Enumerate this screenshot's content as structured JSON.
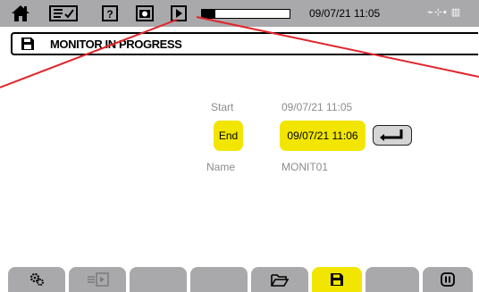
{
  "status_bar": {
    "icons": [
      "home-icon",
      "checklist-icon",
      "help-icon",
      "camera-icon",
      "play-icon"
    ],
    "recording_progress": 0.15,
    "datetime": "09/07/21 11:05",
    "status_glyphs": "⌁⊹▪ ▥"
  },
  "title": {
    "icon": "save-icon",
    "text": "MONITOR IN PROGRESS"
  },
  "form": {
    "start_label": "Start",
    "start_value": "09/07/21 11:05",
    "end_label": "End",
    "end_value": "09/07/21 11:06",
    "name_label": "Name",
    "name_value": "MONIT01",
    "enter_icon": "enter-icon"
  },
  "tabs": [
    {
      "icon": "settings-gears-icon",
      "active": false
    },
    {
      "icon": "import-icon",
      "active": false
    },
    {
      "icon": "",
      "active": false
    },
    {
      "icon": "",
      "active": false
    },
    {
      "icon": "folder-icon",
      "active": false
    },
    {
      "icon": "save-icon",
      "active": true
    },
    {
      "icon": "",
      "active": false
    },
    {
      "icon": "pause-icon",
      "active": false
    }
  ],
  "colors": {
    "bar_gray": "#a9a9ab",
    "highlight_yellow": "#f2e600",
    "pointer_red": "#e0262b",
    "label_gray": "#8c8c8c"
  }
}
